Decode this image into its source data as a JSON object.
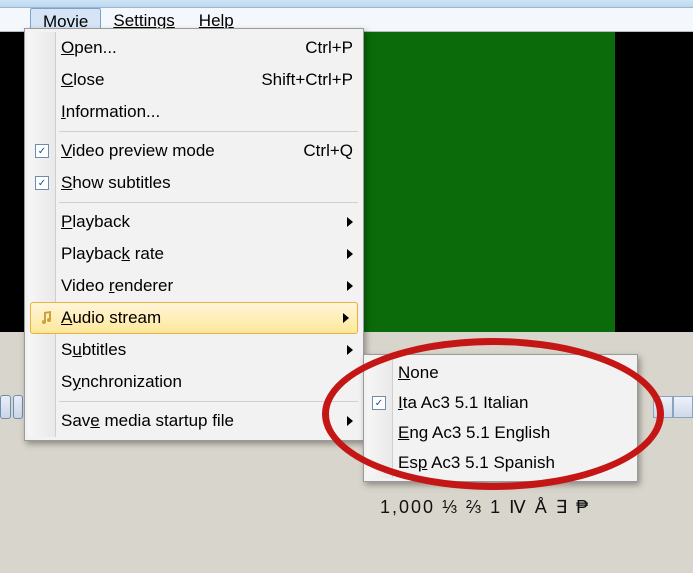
{
  "menubar": {
    "items": [
      "Movie",
      "Settings",
      "Help"
    ]
  },
  "dropdown": {
    "open": {
      "label_pre": "",
      "label_ul": "O",
      "label_post": "pen...",
      "shortcut": "Ctrl+P"
    },
    "close": {
      "label_pre": "",
      "label_ul": "C",
      "label_post": "lose",
      "shortcut": "Shift+Ctrl+P"
    },
    "info": {
      "label_pre": "",
      "label_ul": "I",
      "label_post": "nformation..."
    },
    "video_prev": {
      "label_pre": "",
      "label_ul": "V",
      "label_post": "ideo preview mode",
      "shortcut": "Ctrl+Q"
    },
    "show_subs": {
      "label_pre": "",
      "label_ul": "S",
      "label_post": "how subtitles"
    },
    "playback": {
      "label_pre": "",
      "label_ul": "P",
      "label_post": "layback"
    },
    "playback_rate": {
      "label_pre": "Playbac",
      "label_ul": "k",
      "label_post": " rate"
    },
    "video_rend": {
      "label_pre": "Video ",
      "label_ul": "r",
      "label_post": "enderer"
    },
    "audio_stream": {
      "label_pre": "",
      "label_ul": "A",
      "label_post": "udio stream"
    },
    "subtitles": {
      "label_pre": "S",
      "label_ul": "u",
      "label_post": "btitles"
    },
    "sync": {
      "label_pre": "S",
      "label_ul": "y",
      "label_post": "nchronization"
    },
    "save_startup": {
      "label_pre": "Sav",
      "label_ul": "e",
      "label_post": " media startup file"
    }
  },
  "submenu": {
    "none": {
      "label_pre": "",
      "label_ul": "N",
      "label_post": "one"
    },
    "ita": {
      "label_pre": "",
      "label_ul": "I",
      "label_post": "ta Ac3 5.1 Italian"
    },
    "eng": {
      "label_pre": "",
      "label_ul": "E",
      "label_post": "ng Ac3 5.1 English"
    },
    "esp": {
      "label_pre": "Es",
      "label_ul": "p",
      "label_post": " Ac3 5.1 Spanish"
    }
  },
  "char_row": "1,000  ⅓ ⅔ 1 Ⅳ Å ∃ ₱"
}
